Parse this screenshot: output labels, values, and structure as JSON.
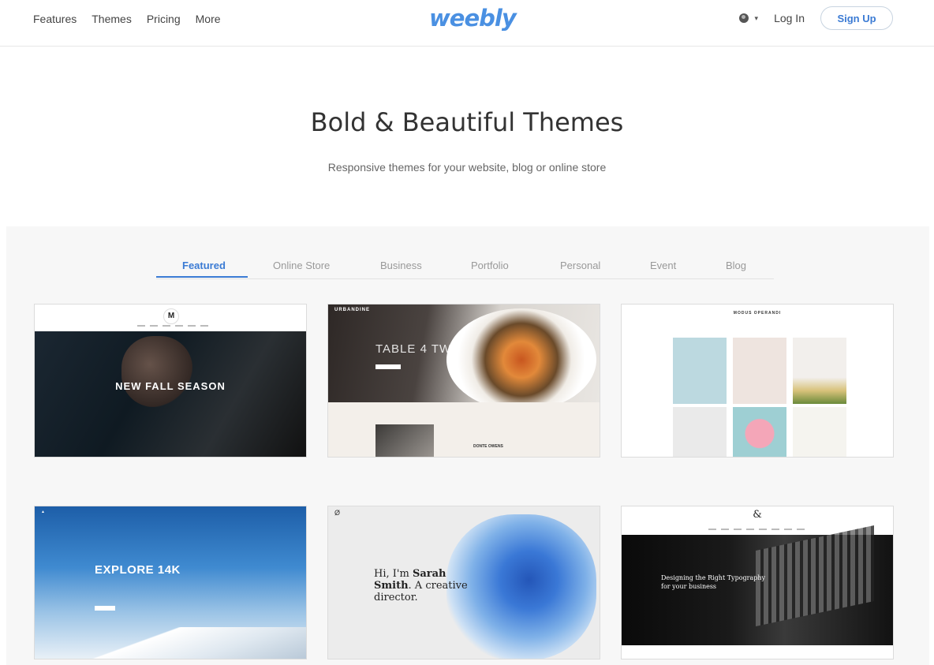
{
  "header": {
    "nav": [
      "Features",
      "Themes",
      "Pricing",
      "More"
    ],
    "logo": "weebly",
    "language_icon": "globe-icon",
    "login": "Log In",
    "signup": "Sign Up"
  },
  "hero": {
    "title": "Bold & Beautiful Themes",
    "subtitle": "Responsive themes for your website, blog or online store"
  },
  "tabs": {
    "items": [
      "Featured",
      "Online Store",
      "Business",
      "Portfolio",
      "Personal",
      "Event",
      "Blog"
    ],
    "active": "Featured"
  },
  "themes": [
    {
      "headline": "NEW FALL SEASON",
      "logo": "M"
    },
    {
      "brand": "URBANDINE",
      "headline": "TABLE 4 TWO",
      "label": "DONTE OWENS"
    },
    {
      "brand": "MODUS OPERANDI"
    },
    {
      "headline": "EXPLORE 14K"
    },
    {
      "logo": "Ø",
      "headline_a": "Hi, I'm ",
      "headline_b": "Sarah",
      "headline_c": "Smith",
      "headline_d": ". A creative",
      "headline_e": "director."
    },
    {
      "logo": "&",
      "headline": "Designing the Right Typography",
      "headline2": "for your business"
    }
  ],
  "colors": {
    "accent": "#3b7bd4",
    "logo": "#4a90e2",
    "gallery_bg": "#f7f7f7"
  }
}
